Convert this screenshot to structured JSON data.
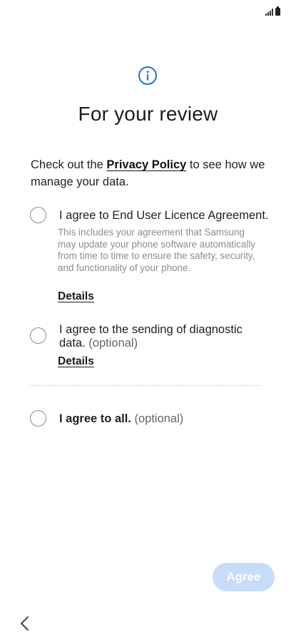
{
  "header": {
    "title": "For your review"
  },
  "intro": {
    "prefix": "Check out the ",
    "link": "Privacy Policy",
    "suffix": " to see how we manage your data."
  },
  "options": {
    "eula": {
      "title": "I agree to End User Licence Agreement.",
      "description": "This includes your agreement that Samsung may update your phone software automatically from time to time to ensure the safety, security, and functionality of your phone.",
      "details": "Details"
    },
    "diagnostic": {
      "title": "I agree to the sending of diagnostic data.",
      "optional": "(optional)",
      "details": "Details"
    },
    "all": {
      "title": "I agree to all.",
      "optional": "(optional)"
    }
  },
  "footer": {
    "agree_label": "Agree"
  },
  "colors": {
    "accent": "#1a73d9",
    "agree_disabled": "#c7dcf8"
  }
}
